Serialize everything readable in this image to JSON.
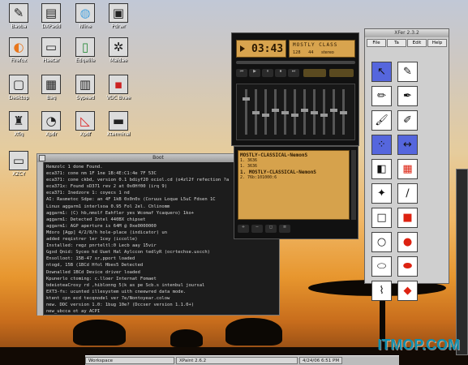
{
  "desktop_icons": [
    {
      "label": "Baoba",
      "icon": "pen-icon"
    },
    {
      "label": "DXPadd",
      "icon": "pad-icon"
    },
    {
      "label": "Nline",
      "icon": "globe-icon"
    },
    {
      "label": "Pdrwr",
      "icon": "box-icon"
    },
    {
      "label": "Firefox",
      "icon": "firefox-icon"
    },
    {
      "label": "Haetar",
      "icon": "monitor-icon"
    },
    {
      "label": "Edgelile",
      "icon": "file-icon"
    },
    {
      "label": "Maidae",
      "icon": "gears-icon"
    },
    {
      "label": "Desktop",
      "icon": "computer-icon"
    },
    {
      "label": "Bag",
      "icon": "bag-icon"
    },
    {
      "label": "Sypead",
      "icon": "spread-icon"
    },
    {
      "label": "VDC Bvae",
      "icon": "vdc-icon"
    },
    {
      "label": "Xfig",
      "icon": "penguin-icon"
    },
    {
      "label": "Xpdr",
      "icon": "drop-icon"
    },
    {
      "label": "Xpdf",
      "icon": "pdf-icon"
    },
    {
      "label": "Xterminal",
      "icon": "terminal-icon"
    },
    {
      "label": "XZCY",
      "icon": "screen-icon"
    }
  ],
  "log_window": {
    "title": "Boot",
    "lines": [
      "Remzolc 1 done Found.",
      "eca371: cone nm 1F 1ne 1B:4E:C1:4e 7F 53C",
      "eca371: cone ckbd, version 0.1 bdiyf20 ociol.cd (o4zl2f refection ?a",
      "eca371x: Found sD371 rev 2 at 0x0Hf00 (irq 9)",
      "eca371: Inedzore 1: coyecs 1 nd",
      "AI: Rasmetoc Sdpe: an 4F 1kB 0x0n0x (Coruus Loque L5uC Fdsen 1C",
      "Linux aggarm1 interlsoa 0.95 Fol 2el. Chlinomm",
      "aggarm1: (C) hb,nmolf Eahfler yes Wcomaf Ycaquero) 1ko+",
      "aggarm1: Detected Intel 440BX chipset",
      "aggarm1: AGP aperture is 64M @ 0xe0000000",
      "Mdoro [Agp] 4/2/8/h hole-place (indicator) un",
      "added reqistrer ler 1cey (iccolle)",
      "Installed: regz pnrteltl:0 Lecb aay 15vir",
      "Ggxd Qnid: Syceo hd Uuet Hal Aylccon tedlyR (ocrtechse.uscch)",
      "Ensolloot: 15B-47 sr,pport loaded",
      "ntogd, 15B (1BCd Hfol Hbes5 Detected",
      "Downalled 1BCd Device driver loaded",
      "Kpunerlo ctoming: c.lloer Internat Fomaet",
      "bdeioteaCrosy rd ,hiblonng 5(k as pe Scb.s intenbul joursal",
      "EXT3-fs: ucunted illesystem uith cneewred data mode.",
      "ktent cpn ecd tecqnodel ver 7e/Nontoyear.colow",
      "new. DDC version 1.0: 1bug 10e? (Dccser version 1.1.0+)",
      "new_ubcca ot ay ACPI",
      "edleboot2"
    ]
  },
  "xmms": {
    "time": "03:43",
    "track_scroll": "MOSTLY CLASS",
    "kbps": "128",
    "khz": "44",
    "mode": "stereo"
  },
  "playlist": {
    "title": "MOSTLY-CLASSICAL-NemonS",
    "entries": [
      "1. 3636",
      "1. 3636",
      "1. MOSTLY-CLASSICAL-NemonS",
      "2. 76b:101000:6"
    ]
  },
  "xfig": {
    "title": "XFer 2.3.2",
    "menu": [
      "File",
      "Ta",
      "Edit",
      "Help"
    ],
    "tools": [
      "select-tool-icon",
      "pointer-tool-icon",
      "pencil-tool-icon",
      "pen-tool-icon",
      "brush-tool-icon",
      "nib-tool-icon",
      "spread-tool-icon",
      "arrows-tool-icon",
      "fill-tool-icon",
      "palette-tool-icon",
      "dropper-tool-icon",
      "rule-tool-icon",
      "rect-tool-icon",
      "redrect-tool-icon",
      "circle-tool-icon",
      "redcircle-tool-icon",
      "ellipse-tool-icon",
      "redellipse-tool-icon",
      "blob-tool-icon",
      "redblob-tool-icon"
    ]
  },
  "taskbar": {
    "items": [
      "Workspace",
      "XPaint 2.6.2",
      "4/24/06 6:51 PM"
    ]
  },
  "watermark": "ITMOP.COM"
}
